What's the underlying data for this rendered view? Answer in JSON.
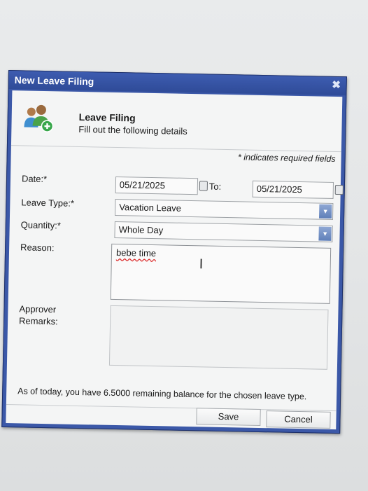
{
  "window": {
    "title": "New Leave Filing",
    "close_glyph": "✖"
  },
  "header": {
    "title": "Leave Filing",
    "subtitle": "Fill out the following details",
    "icon": "users-add-icon"
  },
  "required_note": "* indicates required fields",
  "form": {
    "date_label": "Date:*",
    "date_from": "05/21/2025",
    "to_label": "To:",
    "date_to": "05/21/2025",
    "leave_type_label": "Leave Type:*",
    "leave_type_value": "Vacation Leave",
    "quantity_label": "Quantity:*",
    "quantity_value": "Whole Day",
    "reason_label": "Reason:",
    "reason_value": "bebe time",
    "approver_label_1": "Approver",
    "approver_label_2": "Remarks:",
    "approver_value": ""
  },
  "balance_text": "As of today, you have 6.5000 remaining balance for the chosen leave type.",
  "buttons": {
    "save": "Save",
    "cancel": "Cancel"
  },
  "colors": {
    "titlebar": "#2f4b98",
    "client_bg": "#f4f5f5"
  }
}
